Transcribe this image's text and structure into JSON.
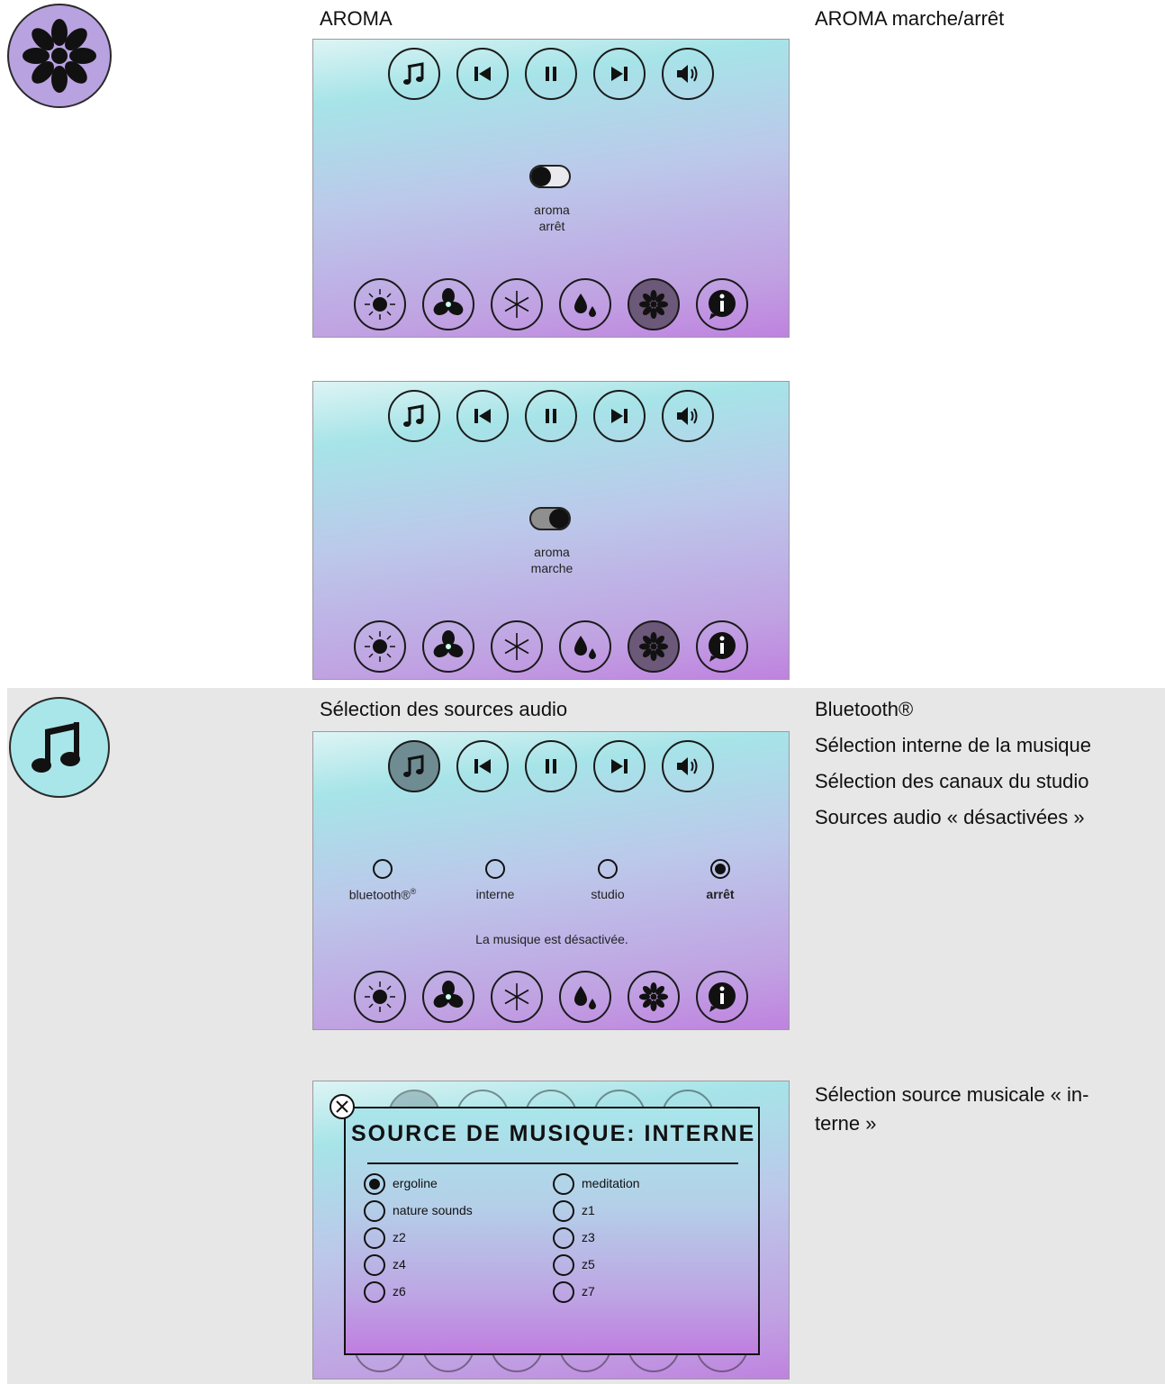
{
  "aroma_section": {
    "heading": "AROMA",
    "note": "AROMA marche/arrêt",
    "screen_off": {
      "toggle_label_1": "aroma",
      "toggle_label_2": "arrêt",
      "toggle_on": false
    },
    "screen_on": {
      "toggle_label_1": "aroma",
      "toggle_label_2": "marche",
      "toggle_on": true
    }
  },
  "audio_section": {
    "heading": "Sélection des sources audio",
    "notes": [
      "Bluetooth®",
      "Sélection interne de la musique",
      "Sélection des canaux du studio",
      "Sources audio « désactivées »"
    ],
    "sources": [
      {
        "label": "bluetooth®",
        "superscript": "®",
        "selected": false
      },
      {
        "label": "interne",
        "selected": false
      },
      {
        "label": "studio",
        "selected": false
      },
      {
        "label": "arrêt",
        "selected": true
      }
    ],
    "message": "La musique est désactivée."
  },
  "internal_section": {
    "note": "Sélection source musicale « in-\nterne »",
    "dialog_title": "SOURCE DE MUSIQUE: INTERNE",
    "options": [
      {
        "label": "ergoline",
        "selected": true
      },
      {
        "label": "meditation",
        "selected": false
      },
      {
        "label": "nature sounds",
        "selected": false
      },
      {
        "label": "z1",
        "selected": false
      },
      {
        "label": "z2",
        "selected": false
      },
      {
        "label": "z3",
        "selected": false
      },
      {
        "label": "z4",
        "selected": false
      },
      {
        "label": "z5",
        "selected": false
      },
      {
        "label": "z6",
        "selected": false
      },
      {
        "label": "z7",
        "selected": false
      }
    ]
  },
  "icons": {
    "top_bar": [
      "music-note-icon",
      "previous-track-icon",
      "pause-icon",
      "next-track-icon",
      "volume-icon"
    ],
    "bottom_bar": [
      "sun-icon",
      "fan-icon",
      "snowflake-icon",
      "water-drops-icon",
      "aroma-flower-icon",
      "info-icon"
    ]
  },
  "colors": {
    "aroma_icon_bg": "#b9a2e0",
    "music_icon_bg": "#a8e6ea",
    "active_aroma_button": "#6c5878",
    "active_music_button": "#6e8c92",
    "band_background": "#e7e7e7"
  }
}
